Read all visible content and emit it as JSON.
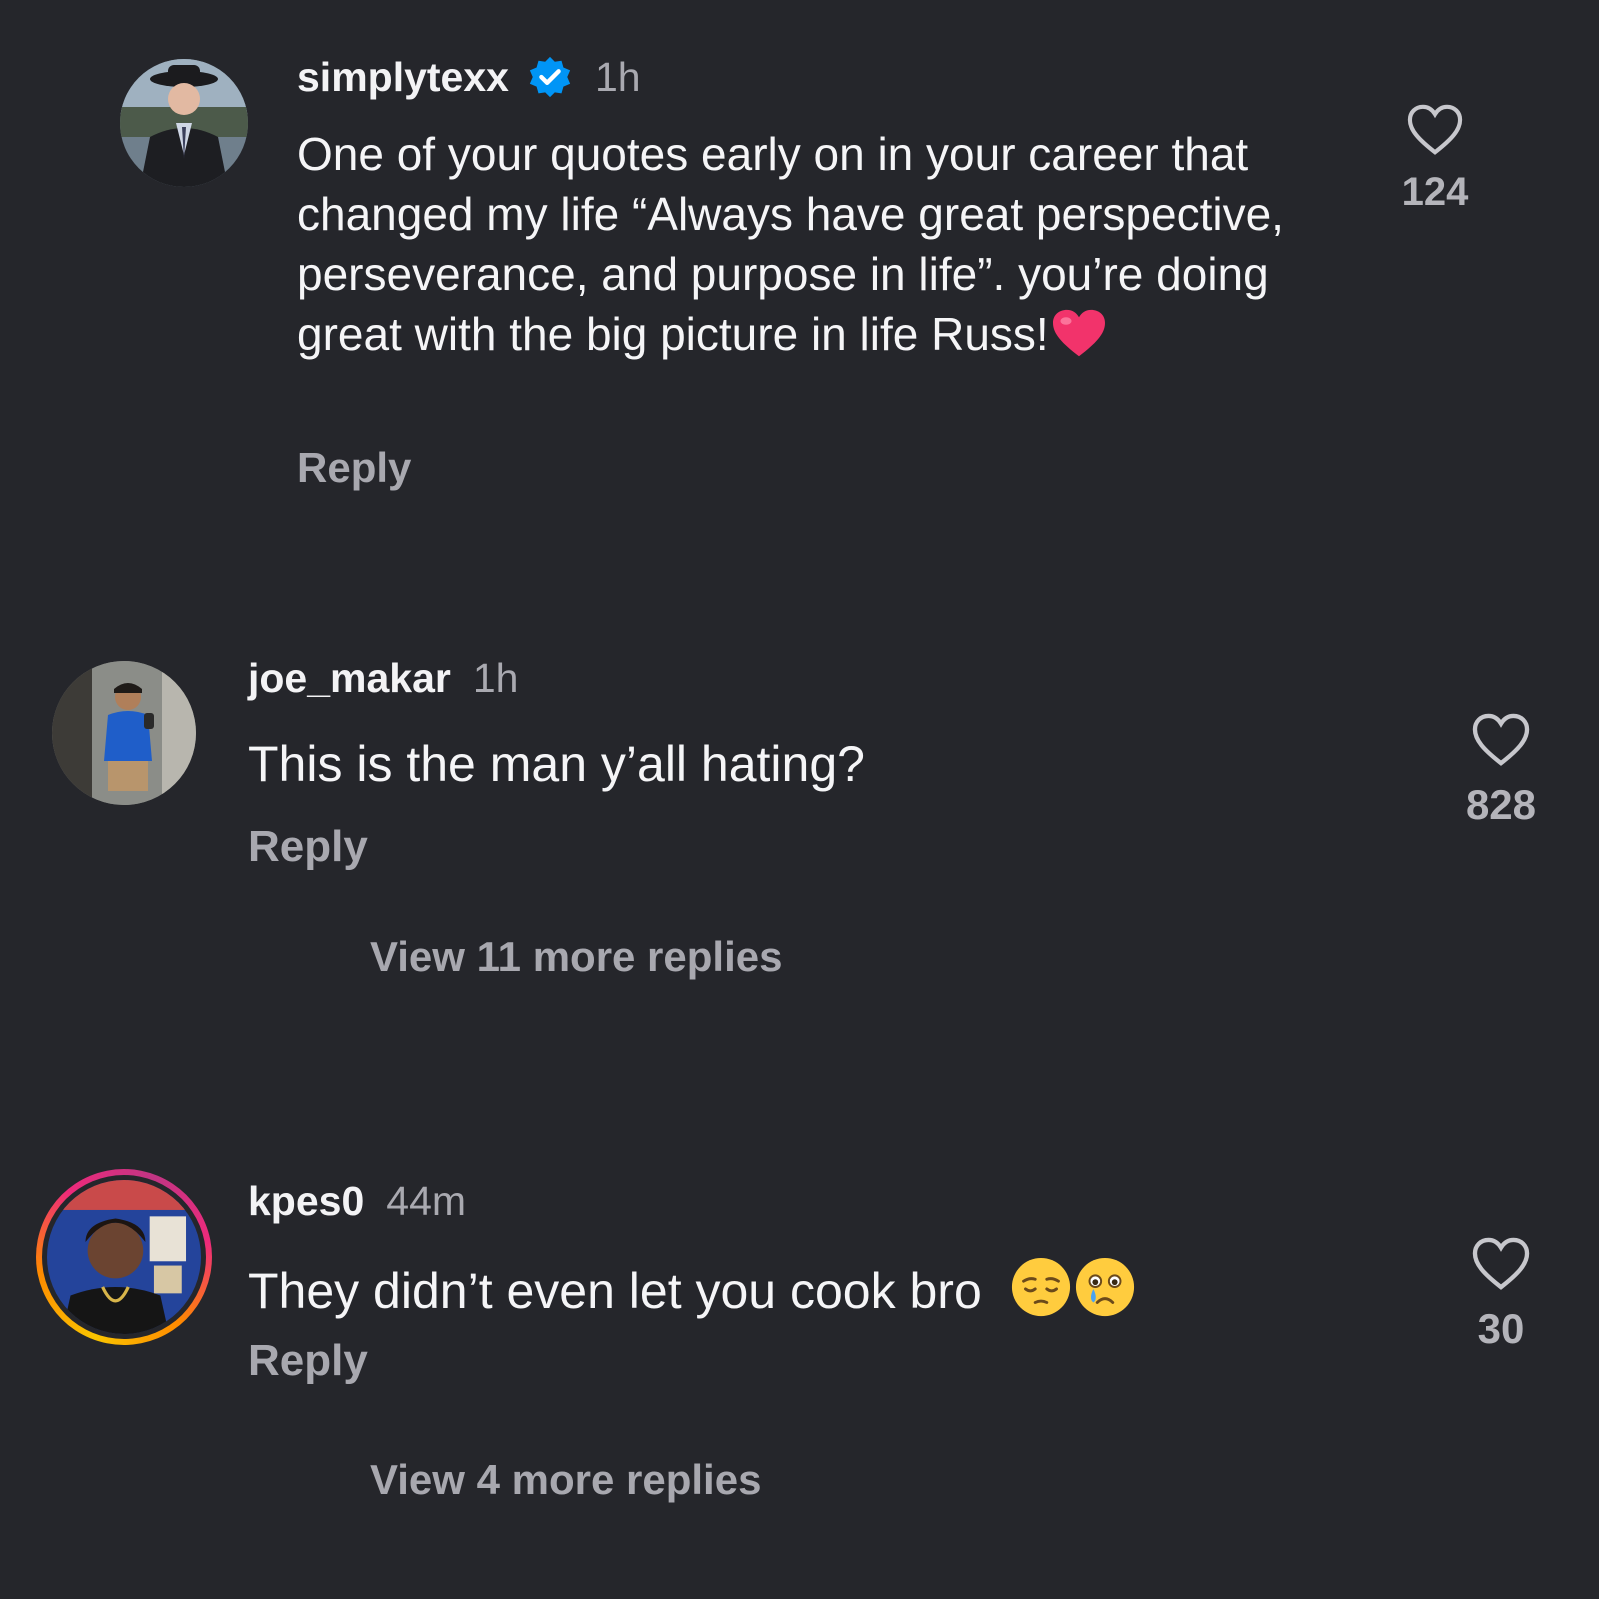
{
  "comments": [
    {
      "username": "simplytexx",
      "verified": true,
      "time": "1h",
      "text": "One of your quotes early on in your career that changed my life “Always have great perspective, perseverance, and purpose in life”. you’re doing great with the big picture in life Russ!",
      "trailing_emoji": "red-heart",
      "reply_label": "Reply",
      "likes": "124",
      "has_story_ring": false
    },
    {
      "username": "joe_makar",
      "verified": false,
      "time": "1h",
      "text": "This is the man y’all hating?",
      "reply_label": "Reply",
      "likes": "828",
      "view_replies": "View 11 more replies",
      "has_story_ring": false
    },
    {
      "username": "kpes0",
      "verified": false,
      "time": "44m",
      "text": "They didn’t even let you cook bro",
      "trailing_emojis": [
        "pensive-face",
        "crying-face"
      ],
      "reply_label": "Reply",
      "likes": "30",
      "view_replies": "View 4 more replies",
      "has_story_ring": true
    }
  ],
  "colors": {
    "background": "#25262b",
    "text_primary": "#f5f5f7",
    "text_secondary": "#a8a8af",
    "verified_blue": "#0095f6"
  }
}
